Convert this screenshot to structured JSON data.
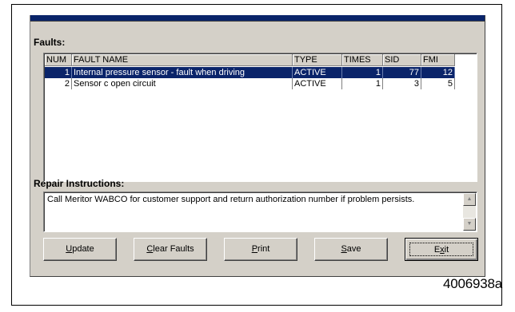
{
  "faults": {
    "label": "Faults:",
    "columns": [
      "NUM",
      "FAULT NAME",
      "TYPE",
      "TIMES",
      "SID",
      "FMI"
    ],
    "rows": [
      {
        "num": "1",
        "name": "Internal pressure sensor - fault when driving",
        "type": "ACTIVE",
        "times": "1",
        "sid": "77",
        "fmi": "12",
        "selected": true
      },
      {
        "num": "2",
        "name": "Sensor c open circuit",
        "type": "ACTIVE",
        "times": "1",
        "sid": "3",
        "fmi": "5",
        "selected": false
      }
    ]
  },
  "repair": {
    "label": "Repair Instructions:",
    "text": "Call Meritor WABCO for customer support and return authorization number if problem persists."
  },
  "buttons": {
    "update": {
      "mnemonic": "U",
      "rest": "pdate"
    },
    "clear": {
      "mnemonic": "C",
      "rest": "lear Faults"
    },
    "print": {
      "mnemonic": "P",
      "rest": "rint"
    },
    "save": {
      "mnemonic": "S",
      "rest": "ave"
    },
    "exit": {
      "pre": "E",
      "mnemonic": "x",
      "rest": "it"
    }
  },
  "figure_id": "4006938a",
  "colors": {
    "selection": "#0a246a",
    "face": "#d4d0c8",
    "titlebar": "#0a246a"
  }
}
